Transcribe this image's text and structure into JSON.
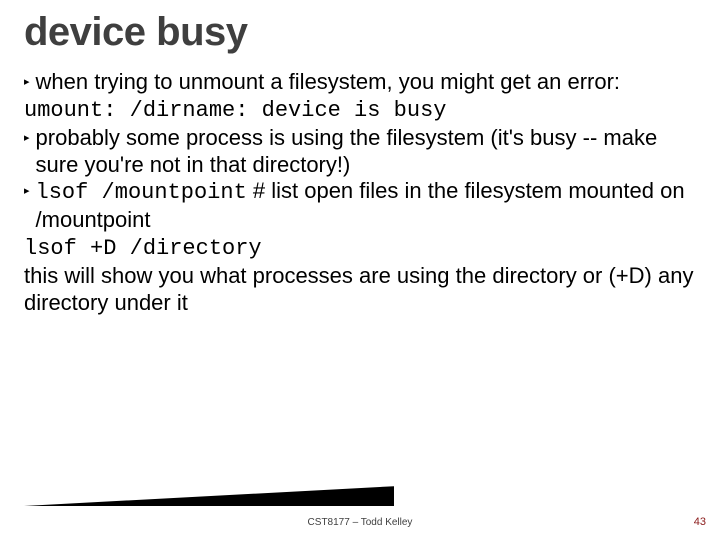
{
  "title": "device busy",
  "bullets": [
    {
      "marker": "▸",
      "text": "when trying to unmount a filesystem, you might get an error:"
    },
    {
      "marker": "",
      "mono": "umount: /dirname: device is busy"
    },
    {
      "marker": "▸",
      "text": "probably some process is using the filesystem (it's busy -- make sure you're not in that directory!)"
    },
    {
      "marker": "▸",
      "mono_prefix": "lsof /mountpoint",
      "text_suffix": "  # list open files in the filesystem mounted on /mountpoint"
    },
    {
      "marker": "",
      "mono": "lsof +D /directory"
    },
    {
      "marker": "",
      "text": "this will show you what processes are using the directory or (+D) any directory under it"
    }
  ],
  "footer": "CST8177 – Todd Kelley",
  "page": "43"
}
